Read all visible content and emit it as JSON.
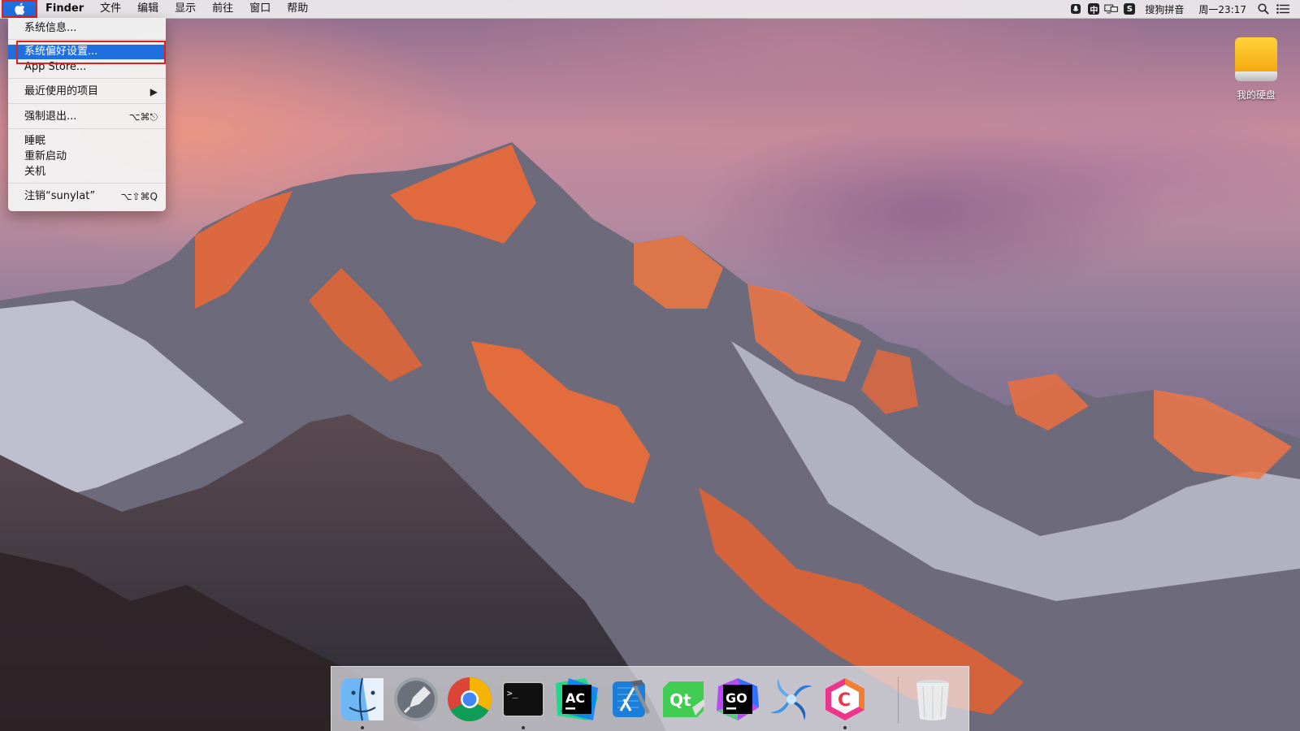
{
  "menubar": {
    "apple_icon": "apple-logo",
    "items": [
      "Finder",
      "文件",
      "编辑",
      "显示",
      "前往",
      "窗口",
      "帮助"
    ],
    "status": {
      "mic_icon": "microphone",
      "ime_indicator": "中",
      "display_icon": "screen-mirroring",
      "sogou_icon": "S",
      "ime_name": "搜狗拼音",
      "clock": "周一23:17",
      "search_icon": "magnifier",
      "notification_icon": "list"
    }
  },
  "apple_menu": {
    "items": [
      {
        "label": "系统信息...",
        "shortcut": ""
      },
      {
        "label": "系统偏好设置...",
        "shortcut": "",
        "highlighted": true
      },
      {
        "label": "App Store...",
        "shortcut": ""
      },
      {
        "label": "最近使用的项目",
        "shortcut": "▶"
      },
      {
        "label": "强制退出...",
        "shortcut": "⌥⌘⎋"
      },
      {
        "label": "睡眠",
        "shortcut": ""
      },
      {
        "label": "重新启动",
        "shortcut": ""
      },
      {
        "label": "关机",
        "shortcut": ""
      },
      {
        "label": "注销“sunylat”",
        "shortcut": "⌥⇧⌘Q"
      }
    ]
  },
  "desktop": {
    "drive_label": "我的硬盘"
  },
  "dock": {
    "apps": [
      {
        "name": "Finder",
        "running": true
      },
      {
        "name": "Launchpad",
        "running": false
      },
      {
        "name": "Google Chrome",
        "running": false
      },
      {
        "name": "Terminal",
        "running": true
      },
      {
        "name": "AppCode",
        "running": false
      },
      {
        "name": "Xcode",
        "running": false
      },
      {
        "name": "Qt Creator",
        "running": false
      },
      {
        "name": "GoLand",
        "running": false
      },
      {
        "name": "Vortex",
        "running": false
      },
      {
        "name": "CLion",
        "running": true
      },
      {
        "name": "Trash",
        "running": false
      }
    ],
    "terminal_prompt": ">_",
    "appcode_text": "AC",
    "qt_text": "Qt",
    "goland_text": "GO",
    "clion_text": "C"
  },
  "colors": {
    "accent": "#1f6fe0",
    "annotation_red": "#e0221e"
  }
}
